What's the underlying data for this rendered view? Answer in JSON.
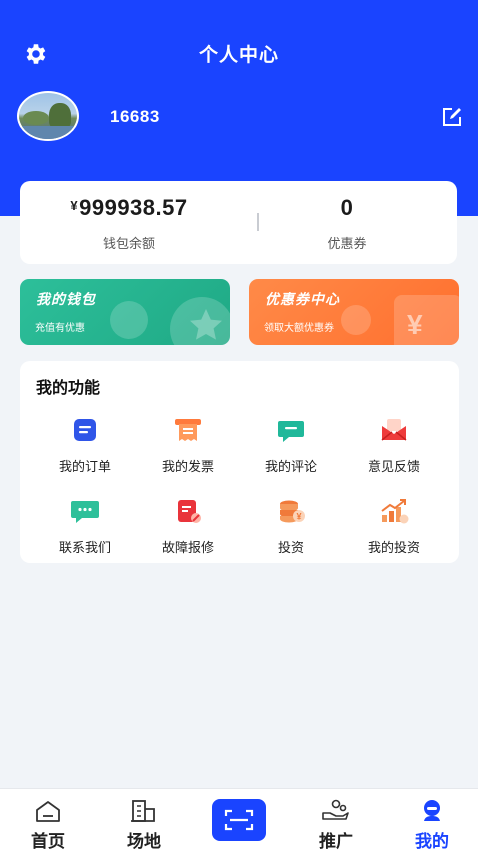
{
  "header": {
    "title": "个人中心",
    "username": "16683"
  },
  "balance": {
    "currency_symbol": "¥",
    "wallet_amount": "999938.57",
    "wallet_label": "钱包余额",
    "coupon_count": "0",
    "coupon_label": "优惠券"
  },
  "promos": {
    "wallet": {
      "title": "我的钱包",
      "subtitle": "充值有优惠"
    },
    "coupon": {
      "title": "优惠券中心",
      "subtitle": "领取大额优惠券",
      "symbol": "¥"
    }
  },
  "functions": {
    "title": "我的功能",
    "items": [
      {
        "label": "我的订单",
        "icon": "order-icon",
        "color": "#2f55e8"
      },
      {
        "label": "我的发票",
        "icon": "invoice-icon",
        "color": "#ff7a3c"
      },
      {
        "label": "我的评论",
        "icon": "comment-icon",
        "color": "#20b89a"
      },
      {
        "label": "意见反馈",
        "icon": "feedback-icon",
        "color": "#ee3b3b"
      },
      {
        "label": "联系我们",
        "icon": "contact-icon",
        "color": "#2ec09a"
      },
      {
        "label": "故障报修",
        "icon": "repair-icon",
        "color": "#e9343b"
      },
      {
        "label": "投资",
        "icon": "investment-coins-icon",
        "color": "#f07a3a"
      },
      {
        "label": "我的投资",
        "icon": "my-investment-icon",
        "color": "#f07a3a"
      }
    ]
  },
  "tabbar": {
    "tabs": [
      {
        "label": "首页",
        "icon": "home-icon"
      },
      {
        "label": "场地",
        "icon": "building-icon"
      },
      {
        "label": "",
        "icon": "scan-icon"
      },
      {
        "label": "推广",
        "icon": "hand-coins-icon"
      },
      {
        "label": "我的",
        "icon": "user-icon",
        "active": true
      }
    ]
  },
  "colors": {
    "brand": "#1a44ff",
    "background": "#f1f4f8",
    "wallet_card": "#22b38f",
    "coupon_card": "#ff7a3c"
  }
}
